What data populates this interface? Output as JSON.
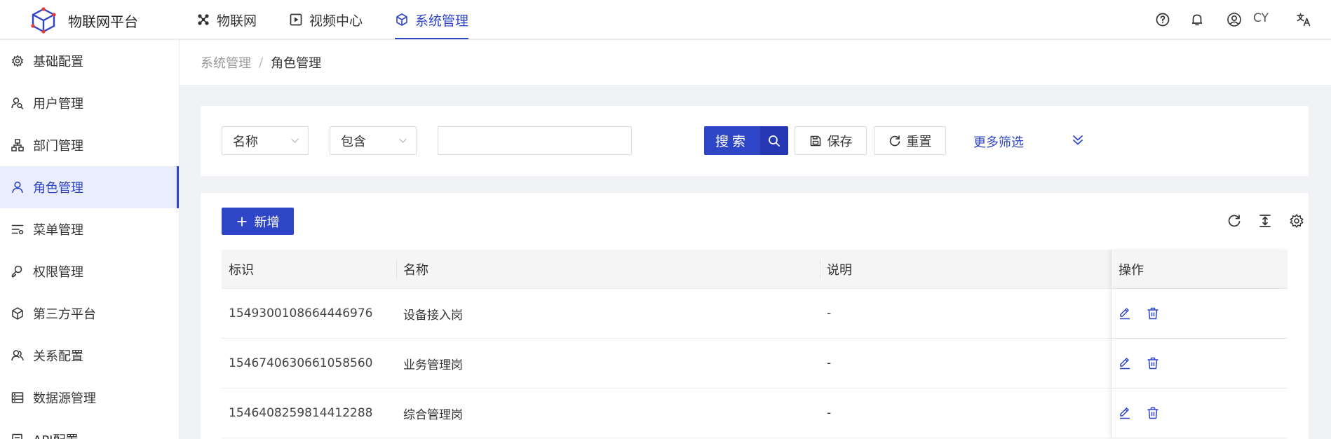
{
  "header": {
    "app_title": "物联网平台",
    "nav_tabs": [
      {
        "label": "物联网",
        "icon": "cluster-icon"
      },
      {
        "label": "视频中心",
        "icon": "play-square-icon"
      },
      {
        "label": "系统管理",
        "icon": "cube-icon",
        "active": true
      }
    ],
    "user_name": "CY",
    "icons": [
      "help-circle-icon",
      "bell-icon",
      "user-avatar-icon",
      "translate-icon"
    ]
  },
  "sidebar": {
    "items": [
      {
        "label": "基础配置",
        "icon": "gear-icon"
      },
      {
        "label": "用户管理",
        "icon": "user-search-icon"
      },
      {
        "label": "部门管理",
        "icon": "org-tree-icon"
      },
      {
        "label": "角色管理",
        "icon": "user-icon",
        "active": true
      },
      {
        "label": "菜单管理",
        "icon": "menu-list-icon"
      },
      {
        "label": "权限管理",
        "icon": "key-user-icon"
      },
      {
        "label": "第三方平台",
        "icon": "cube-icon"
      },
      {
        "label": "关系配置",
        "icon": "users-icon"
      },
      {
        "label": "数据源管理",
        "icon": "database-icon"
      },
      {
        "label": "API配置",
        "icon": "api-doc-icon"
      }
    ]
  },
  "breadcrumb": {
    "parent": "系统管理",
    "separator": "/",
    "current": "角色管理"
  },
  "filter": {
    "field_select": "名称",
    "operator_select": "包含",
    "value": "",
    "search_label": "搜索",
    "save_label": "保存",
    "reset_label": "重置",
    "more_filter_label": "更多筛选"
  },
  "table": {
    "add_label": "新增",
    "columns": [
      "标识",
      "名称",
      "说明",
      "操作"
    ],
    "rows": [
      {
        "id": "1549300108664446976",
        "name": "设备接入岗",
        "desc": "-"
      },
      {
        "id": "1546740630661058560",
        "name": "业务管理岗",
        "desc": "-"
      },
      {
        "id": "1546408259814412288",
        "name": "综合管理岗",
        "desc": "-"
      }
    ],
    "toolbar_icons": [
      "refresh-icon",
      "column-height-icon",
      "settings-icon"
    ]
  },
  "colors": {
    "primary": "#2f45c7",
    "primary_dark": "#2537b3",
    "active_bg": "#eaeefc",
    "page_bg": "#f0f2f5"
  }
}
